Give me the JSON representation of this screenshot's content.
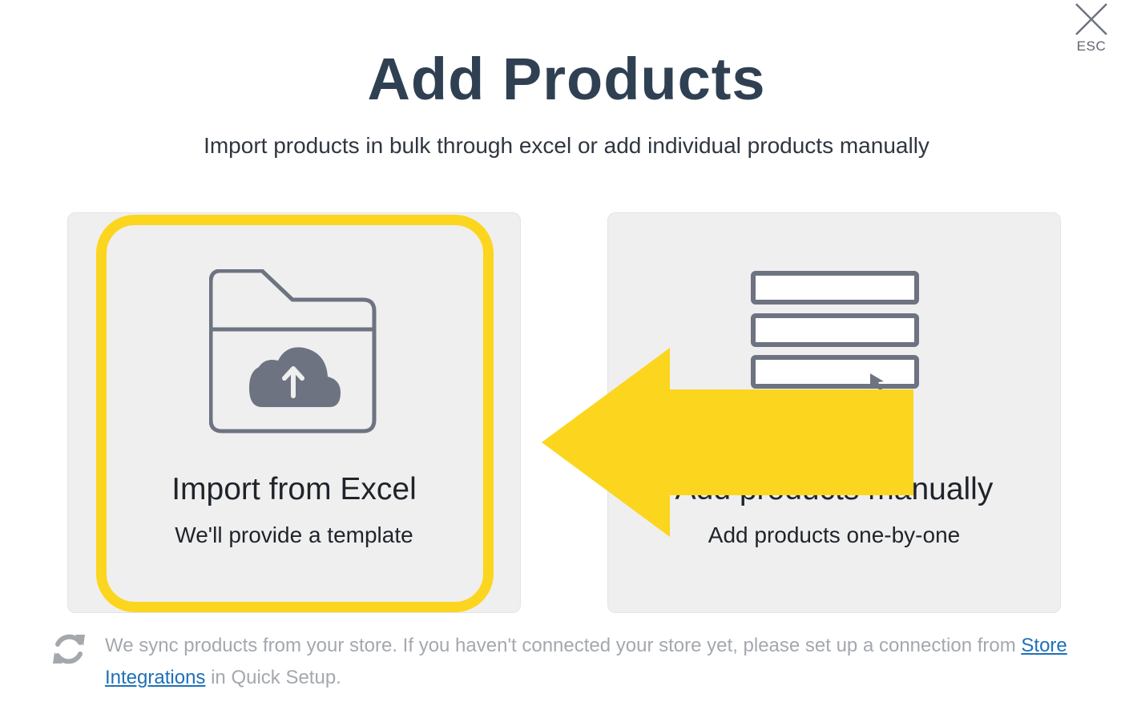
{
  "dialog": {
    "close_label": "ESC",
    "title": "Add Products",
    "subtitle": "Import products in bulk through excel or add individual products manually"
  },
  "cards": [
    {
      "icon": "folder-upload-icon",
      "title": "Import from Excel",
      "subtitle": "We'll provide a template"
    },
    {
      "icon": "form-list-icon",
      "title": "Add products manually",
      "subtitle": "Add products one-by-one"
    }
  ],
  "footer": {
    "icon": "sync-icon",
    "text_before": "We sync products from your store. If you haven't connected your store yet, please set up a connection from ",
    "link": "Store Integrations",
    "text_after": " in Quick Setup."
  },
  "colors": {
    "title": "#2f4053",
    "card_bg": "#efefef",
    "icon": "#6d7380",
    "highlight": "#fcd51f",
    "link": "#1e70b8",
    "footer_text": "#a4a8ae"
  }
}
